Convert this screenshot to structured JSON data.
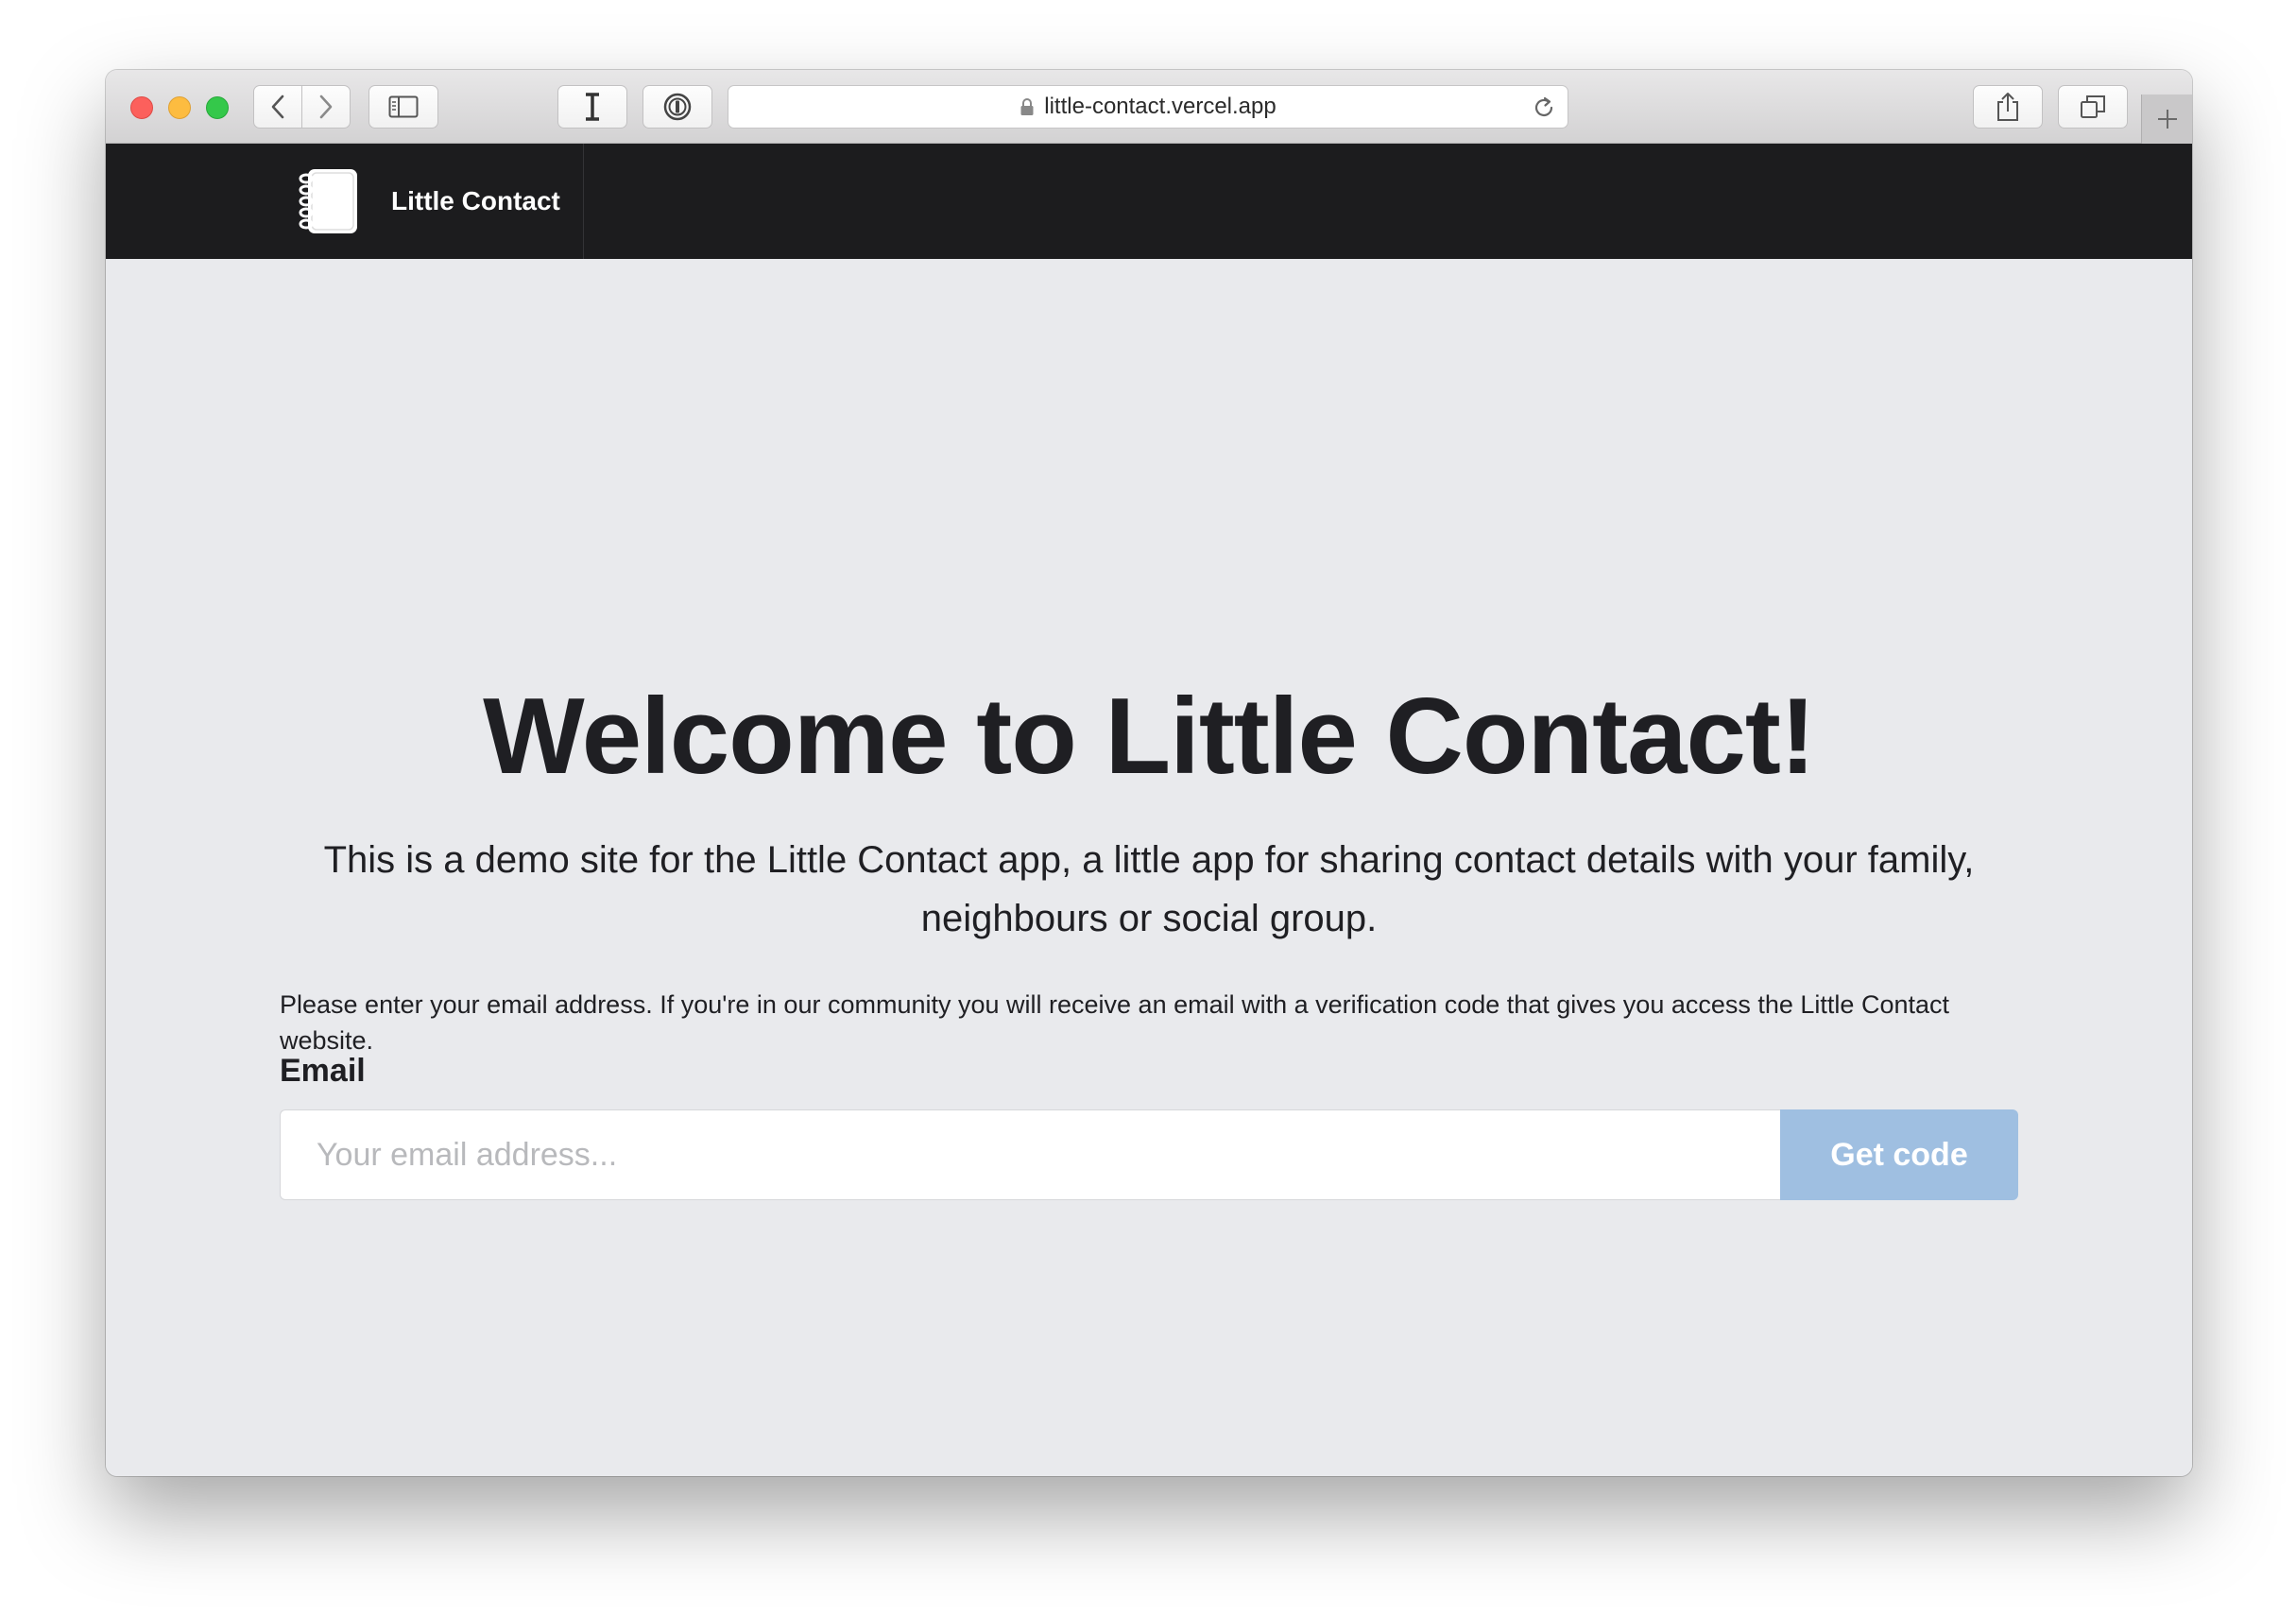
{
  "browser": {
    "url": "little-contact.vercel.app",
    "icons": {
      "back": "chevron-left-icon",
      "forward": "chevron-right-icon",
      "sidebar": "sidebar-icon",
      "reader": "text-cursor-icon",
      "password_manager": "onepassword-icon",
      "lock": "lock-icon",
      "reload": "reload-icon",
      "share": "share-icon",
      "tabs": "tabs-icon",
      "new_tab": "plus-icon"
    }
  },
  "header": {
    "brand_name": "Little Contact",
    "logo_icon": "notebook-icon"
  },
  "main": {
    "title": "Welcome to Little Contact!",
    "subtitle": "This is a demo site for the Little Contact app, a little app for sharing contact details with your family, neighbours or social group.",
    "intro": "Please enter your email address. If you're in our community you will receive an email with a verification code that gives you access the Little Contact website.",
    "email_label": "Email",
    "email_placeholder": "Your email address...",
    "email_value": "",
    "submit_label": "Get code"
  },
  "colors": {
    "header_bg": "#1c1c1e",
    "page_bg": "#e9eaed",
    "button_bg": "#9fbfe1",
    "text": "#1f1f23"
  }
}
